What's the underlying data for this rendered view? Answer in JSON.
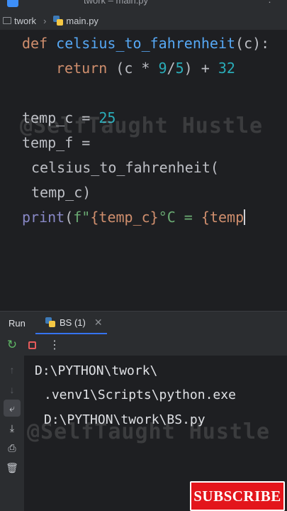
{
  "window": {
    "title": "twork – main.py"
  },
  "breadcrumb": {
    "project": "twork",
    "file": "main.py"
  },
  "editor": {
    "lines": {
      "l1": {
        "kw": "def",
        "name": "celsius_to_fahrenheit",
        "sig": "(c):"
      },
      "l2": {
        "kw": "return",
        "open": " (c * ",
        "n1": "9",
        "div": "/",
        "n2": "5",
        "close": ") + ",
        "n3": "32"
      },
      "l3": {
        "var": "temp_c = ",
        "num": "25"
      },
      "l4": {
        "text": "temp_f ="
      },
      "l5": {
        "text": "celsius_to_fahrenheit("
      },
      "l6": {
        "text": "temp_c)"
      },
      "l7": {
        "builtin": "print",
        "open": "(",
        "str": "f\"",
        "expr": "{temp_c}",
        "str2": "°C = ",
        "expr2": "{temp"
      }
    },
    "watermark": "@SelfTaught Hustle"
  },
  "run_panel": {
    "label": "Run",
    "tab": "BS (1)",
    "output": [
      "D:\\PYTHON\\twork\\",
      ".venv1\\Scripts\\python.exe",
      "D:\\PYTHON\\twork\\BS.py"
    ],
    "watermark": "@SelfTaught Hustle"
  },
  "overlay": {
    "subscribe_label": "SUBSCRIBE"
  },
  "icons": {
    "rerun": "rerun-icon",
    "stop": "stop-icon",
    "more": "more-options-icon"
  },
  "colors": {
    "keyword": "#cf8e6d",
    "function": "#56a8f5",
    "number": "#2aacb8",
    "string": "#6aab73",
    "builtin": "#8888c6",
    "accent": "#3574f0",
    "subscribe_bg": "#e3151b"
  }
}
